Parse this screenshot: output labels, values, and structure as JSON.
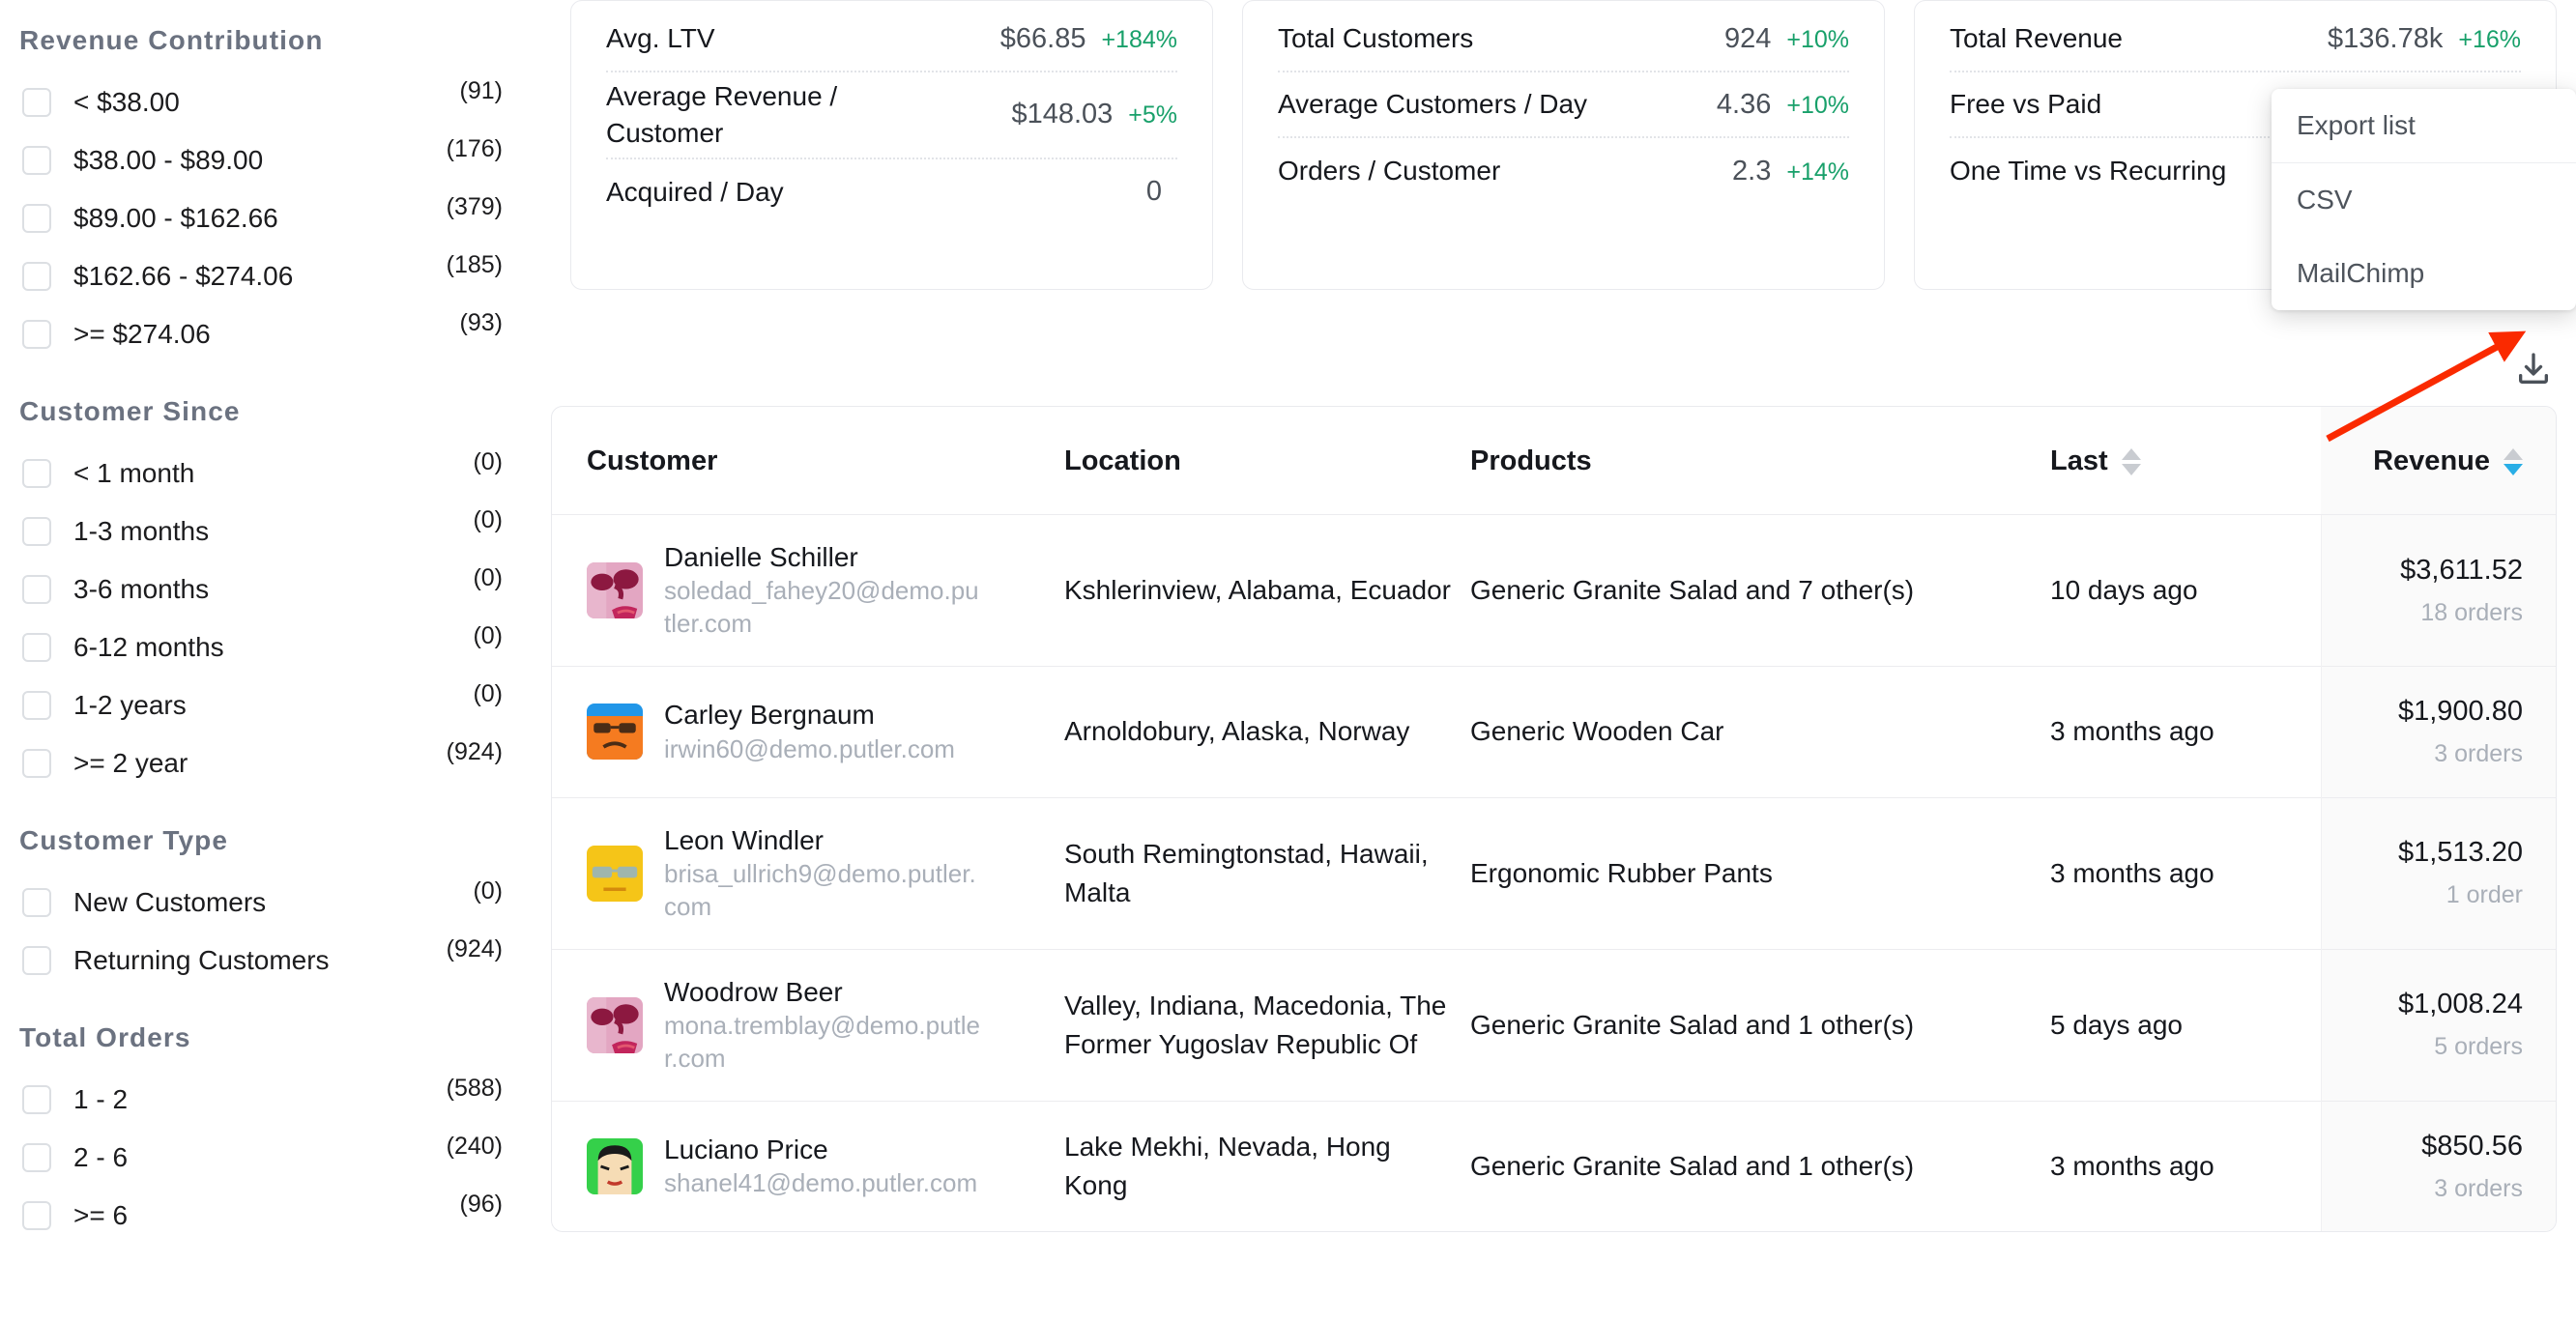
{
  "sidebar": {
    "groups": [
      {
        "title": "Revenue Contribution",
        "items": [
          {
            "label": "< $38.00",
            "count": "(91)"
          },
          {
            "label": "$38.00 - $89.00",
            "count": "(176)"
          },
          {
            "label": "$89.00 - $162.66",
            "count": "(379)"
          },
          {
            "label": "$162.66 - $274.06",
            "count": "(185)"
          },
          {
            "label": ">= $274.06",
            "count": "(93)"
          }
        ]
      },
      {
        "title": "Customer Since",
        "items": [
          {
            "label": "< 1 month",
            "count": "(0)"
          },
          {
            "label": "1-3 months",
            "count": "(0)"
          },
          {
            "label": "3-6 months",
            "count": "(0)"
          },
          {
            "label": "6-12 months",
            "count": "(0)"
          },
          {
            "label": "1-2 years",
            "count": "(0)"
          },
          {
            "label": ">= 2 year",
            "count": "(924)"
          }
        ]
      },
      {
        "title": "Customer Type",
        "items": [
          {
            "label": "New Customers",
            "count": "(0)"
          },
          {
            "label": "Returning Customers",
            "count": "(924)"
          }
        ]
      },
      {
        "title": "Total Orders",
        "items": [
          {
            "label": "1 - 2",
            "count": "(588)"
          },
          {
            "label": "2 - 6",
            "count": "(240)"
          },
          {
            "label": ">= 6",
            "count": "(96)"
          }
        ]
      }
    ]
  },
  "cards": [
    {
      "rows": [
        {
          "label": "Avg. LTV",
          "value": "$66.85",
          "delta": "+184%"
        },
        {
          "label": "Average Revenue / Customer",
          "value": "$148.03",
          "delta": "+5%"
        },
        {
          "label": "Acquired / Day",
          "value": "0",
          "delta": ""
        }
      ]
    },
    {
      "rows": [
        {
          "label": "Total Customers",
          "value": "924",
          "delta": "+10%"
        },
        {
          "label": "Average Customers / Day",
          "value": "4.36",
          "delta": "+10%"
        },
        {
          "label": "Orders / Customer",
          "value": "2.3",
          "delta": "+14%"
        }
      ]
    },
    {
      "rows": [
        {
          "label": "Total Revenue",
          "value": "$136.78k",
          "delta": "+16%"
        },
        {
          "label": "Free vs Paid",
          "value": "",
          "delta": ""
        },
        {
          "label": "One Time vs Recurring",
          "value": "",
          "delta": ""
        }
      ]
    }
  ],
  "export_menu": {
    "header": "Export list",
    "options": [
      "CSV",
      "MailChimp"
    ]
  },
  "toolbar": {
    "download_icon": "download-icon"
  },
  "table": {
    "columns": {
      "customer": "Customer",
      "location": "Location",
      "products": "Products",
      "last": "Last",
      "revenue": "Revenue"
    },
    "sort": {
      "column": "Revenue",
      "direction": "desc"
    },
    "rows": [
      {
        "name": "Danielle Schiller",
        "email": "soledad_fahey20@demo.putler.com",
        "location": "Kshlerinview, Alabama, Ecuador",
        "products": "Generic Granite Salad and 7 other(s)",
        "last": "10 days ago",
        "revenue": "$3,611.52",
        "orders": "18 orders",
        "avatar": "avatar-pink-face"
      },
      {
        "name": "Carley Bergnaum",
        "email": "irwin60@demo.putler.com",
        "location": "Arnoldobury, Alaska, Norway",
        "products": "Generic Wooden Car",
        "last": "3 months ago",
        "revenue": "$1,900.80",
        "orders": "3 orders",
        "avatar": "avatar-orange-sunglasses"
      },
      {
        "name": "Leon Windler",
        "email": "brisa_ullrich9@demo.putler.com",
        "location": "South Remingtonstad, Hawaii, Malta",
        "products": "Ergonomic Rubber Pants",
        "last": "3 months ago",
        "revenue": "$1,513.20",
        "orders": "1 order",
        "avatar": "avatar-yellow-sunglasses"
      },
      {
        "name": "Woodrow Beer",
        "email": "mona.tremblay@demo.putler.com",
        "location": "Valley, Indiana, Macedonia, The Former Yugoslav Republic Of",
        "products": "Generic Granite Salad and 1 other(s)",
        "last": "5 days ago",
        "revenue": "$1,008.24",
        "orders": "5 orders",
        "avatar": "avatar-pink-face"
      },
      {
        "name": "Luciano Price",
        "email": "shanel41@demo.putler.com",
        "location": "Lake Mekhi, Nevada, Hong Kong",
        "products": "Generic Granite Salad and 1 other(s)",
        "last": "3 months ago",
        "revenue": "$850.56",
        "orders": "3 orders",
        "avatar": "avatar-green-face"
      }
    ]
  },
  "colors": {
    "positive": "#18a06a",
    "sort_active": "#29aee6",
    "annotation_arrow": "#fa2a00",
    "muted_text": "#a9afb8"
  }
}
